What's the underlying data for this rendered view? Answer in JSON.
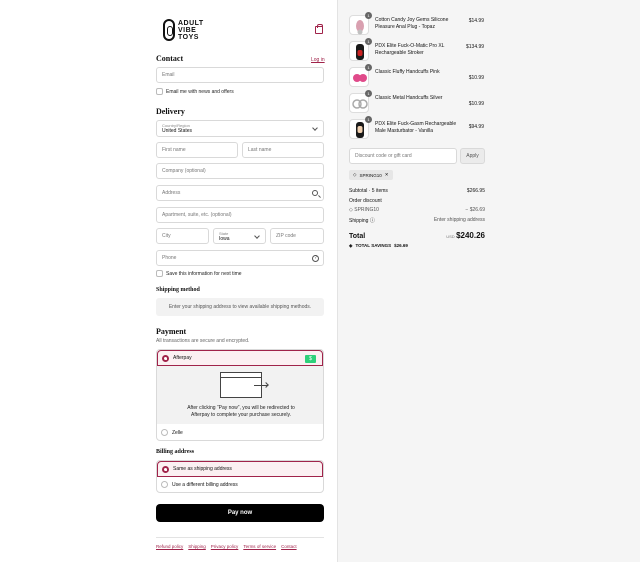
{
  "brand": {
    "line1": "ADULT",
    "line2": "VIBE",
    "line3": "TOYS"
  },
  "contact": {
    "title": "Contact",
    "login": "Log in",
    "email_placeholder": "Email",
    "news_label": "Email me with news and offers"
  },
  "delivery": {
    "title": "Delivery",
    "country_label": "Country/Region",
    "country_value": "United States",
    "first_name": "First name",
    "last_name": "Last name",
    "company": "Company (optional)",
    "address": "Address",
    "apartment": "Apartment, suite, etc. (optional)",
    "city": "City",
    "state_label": "State",
    "state_value": "Iowa",
    "zip": "ZIP code",
    "phone": "Phone",
    "save_label": "Save this information for next time"
  },
  "shipping": {
    "title": "Shipping method",
    "message": "Enter your shipping address to view available shipping methods."
  },
  "payment": {
    "title": "Payment",
    "subtitle": "All transactions are secure and encrypted.",
    "afterpay": "Afterpay",
    "afterpay_badge": "$",
    "redirect_line1": "After clicking “Pay now”, you will be redirected to",
    "redirect_line2": "Afterpay to complete your purchase securely.",
    "zelle": "Zelle"
  },
  "billing": {
    "title": "Billing address",
    "same": "Same as shipping address",
    "different": "Use a different billing address"
  },
  "pay_now": "Pay now",
  "footer": [
    "Refund policy",
    "Shipping",
    "Privacy policy",
    "Terms of service",
    "Contact"
  ],
  "cart": {
    "items": [
      {
        "qty": "1",
        "name": "Cotton Candy Joy Gems Silicone Pleasure Anal Plug - Topaz",
        "price": "$14.99"
      },
      {
        "qty": "1",
        "name": "PDX Elite Fuck-O-Matic Pro XL Rechargeable Stroker",
        "price": "$134.99"
      },
      {
        "qty": "1",
        "name": "Classic Fluffy Handcuffs Pink",
        "price": "$10.99"
      },
      {
        "qty": "1",
        "name": "Classic Metal Handcuffs Silver",
        "price": "$10.99"
      },
      {
        "qty": "1",
        "name": "PDX Elite Fuck-Gasm Rechargeable Male Masturbator - Vanilla",
        "price": "$94.99"
      }
    ],
    "discount_placeholder": "Discount code or gift card",
    "apply": "Apply",
    "code": "SPRING10",
    "subtotal_label": "Subtotal · 5 items",
    "subtotal_value": "$266.95",
    "order_discount_label": "Order discount",
    "discount_code_label": "SPRING10",
    "discount_value": "− $26.69",
    "shipping_label": "Shipping",
    "shipping_value": "Enter shipping address",
    "total_label": "Total",
    "currency": "USD",
    "total_value": "$240.26",
    "savings_label": "TOTAL SAVINGS",
    "savings_value": "$26.69"
  }
}
